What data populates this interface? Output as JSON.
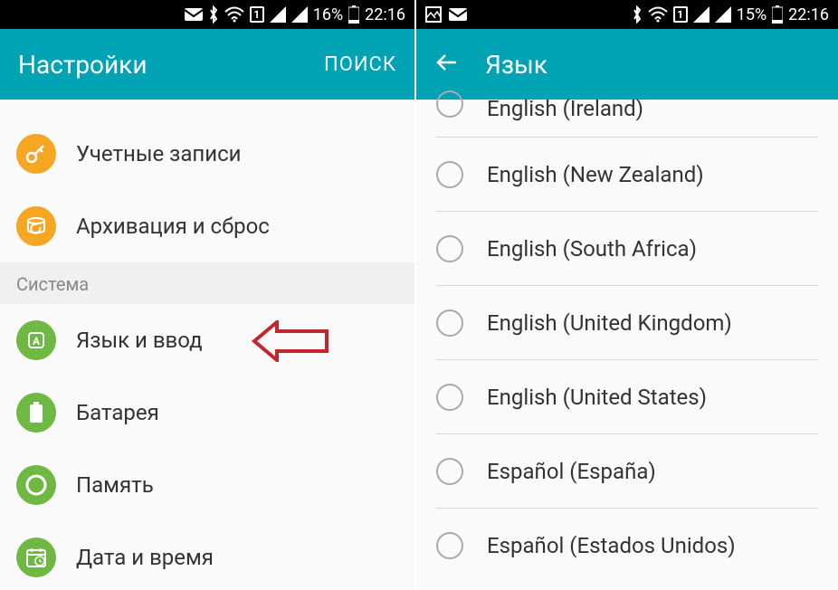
{
  "left": {
    "status": {
      "battery_pct": "16%",
      "time": "22:16",
      "sim": "1"
    },
    "appbar": {
      "title": "Настройки",
      "search": "ПОИСК"
    },
    "items": {
      "accounts": "Учетные записи",
      "backup": "Архивация и сброс",
      "section": "Система",
      "language": "Язык и ввод",
      "battery": "Батарея",
      "memory": "Память",
      "datetime": "Дата и время"
    }
  },
  "right": {
    "status": {
      "battery_pct": "15%",
      "time": "22:16",
      "sim": "1"
    },
    "appbar": {
      "title": "Язык"
    },
    "languages": {
      "ireland": "English (Ireland)",
      "nz": "English (New Zealand)",
      "sa": "English (South Africa)",
      "uk": "English (United Kingdom)",
      "us": "English (United States)",
      "es": "Español (España)",
      "es_us": "Español (Estados Unidos)"
    }
  }
}
